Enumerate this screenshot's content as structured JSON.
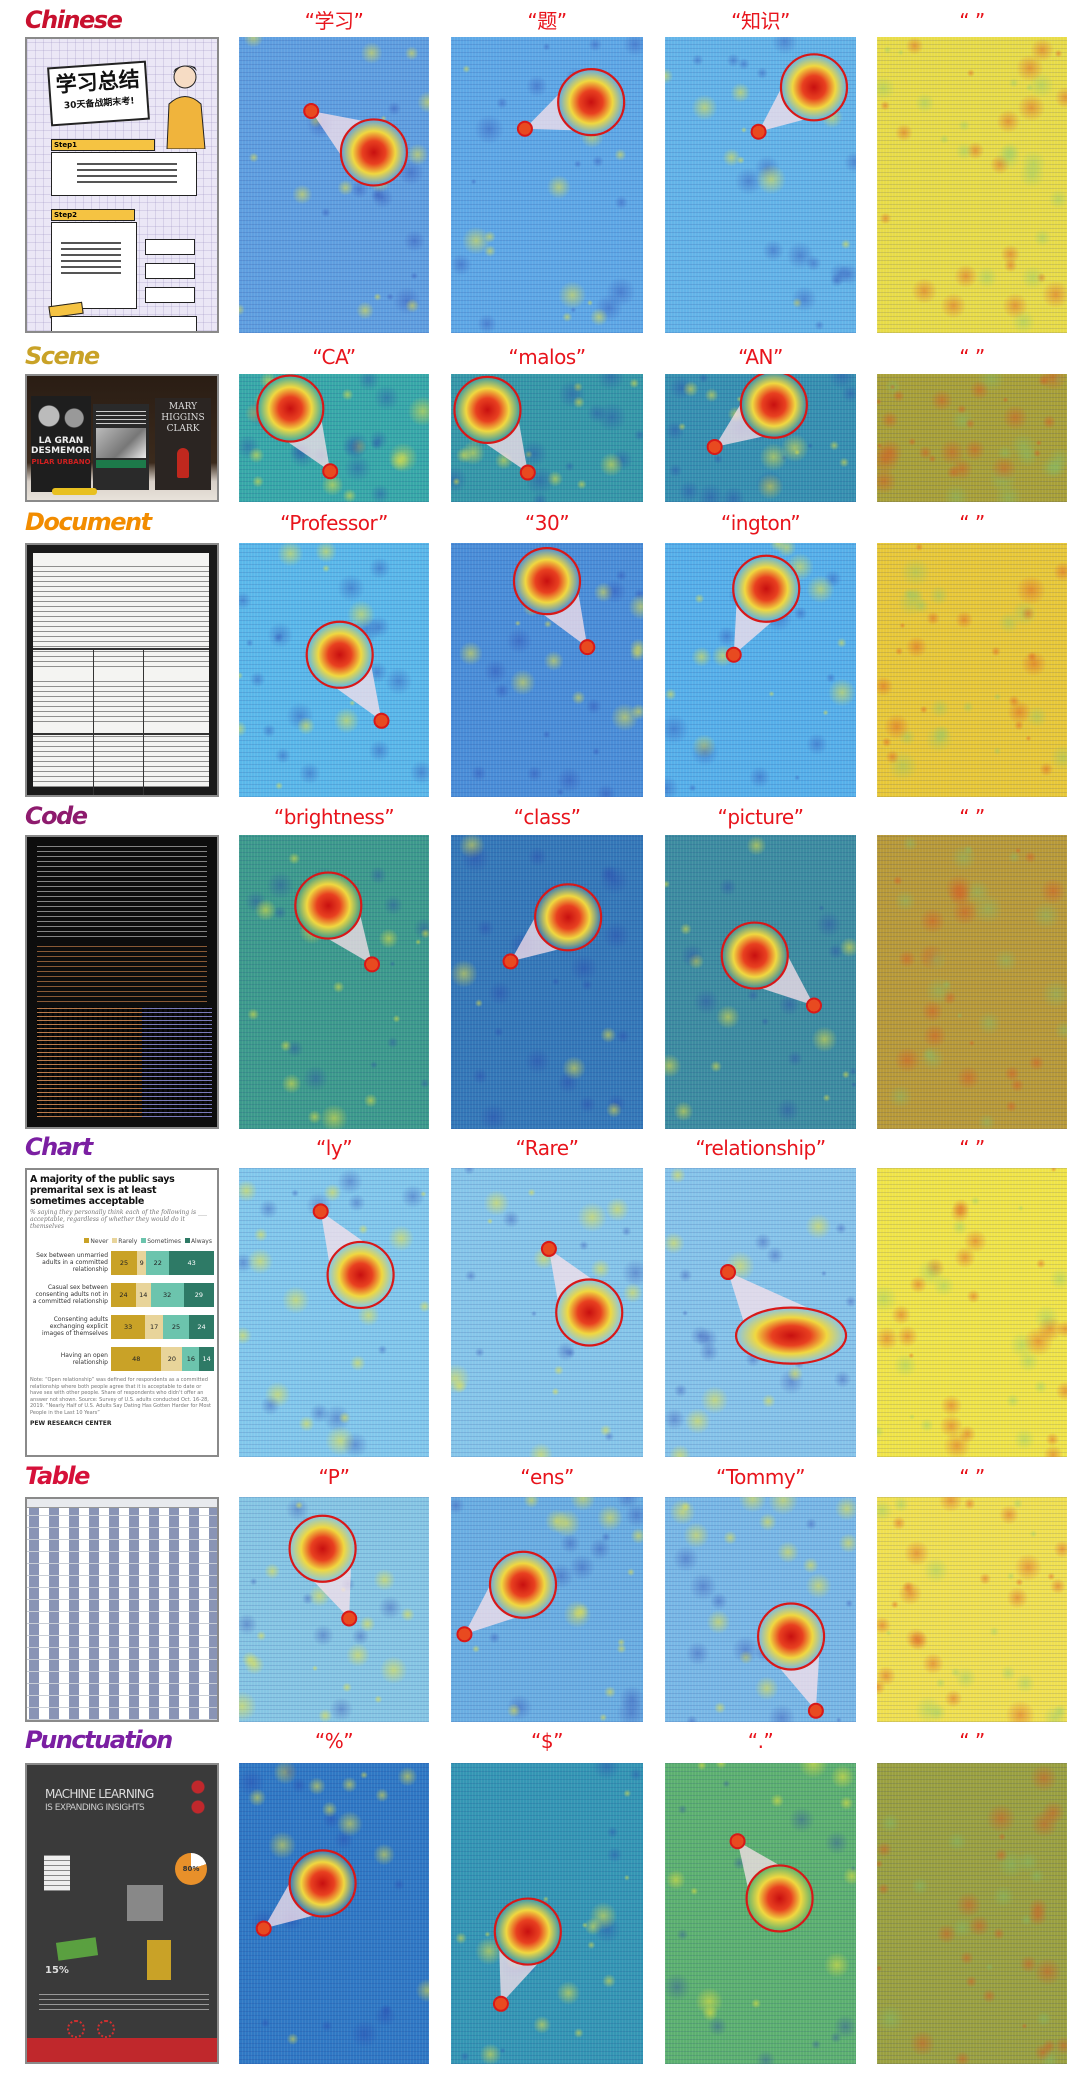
{
  "rows": [
    {
      "category": "Chinese",
      "color": "#c8102e",
      "tokens": [
        "“学习”",
        "“题”",
        "“知识”",
        "“ ”"
      ]
    },
    {
      "category": "Scene",
      "color": "#c9a227",
      "tokens": [
        "“CA”",
        "“malos”",
        "“AN”",
        "“ ”"
      ]
    },
    {
      "category": "Document",
      "color": "#f28c00",
      "tokens": [
        "“Professor”",
        "“30”",
        "“ington”",
        "“ ”"
      ]
    },
    {
      "category": "Code",
      "color": "#8e1b6e",
      "tokens": [
        "“brightness”",
        "“class”",
        "“picture”",
        "“ ”"
      ]
    },
    {
      "category": "Chart",
      "color": "#7b1fa2",
      "tokens": [
        "“ly”",
        "“Rare”",
        "“relationship”",
        "“ ”"
      ]
    },
    {
      "category": "Table",
      "color": "#d6113a",
      "tokens": [
        "“P”",
        "“ens”",
        "“Tommy”",
        "“ ”"
      ]
    },
    {
      "category": "Punctuation",
      "color": "#7b1fa2",
      "tokens": [
        "“%”",
        "“$”",
        "“.”",
        "“ ”"
      ]
    }
  ],
  "token_color": "#e8141c",
  "thumbs": {
    "chinese": {
      "title": "学习总结",
      "subtitle": "30天备战期末考!",
      "step1": "Step1",
      "step2": "Step2"
    },
    "scene": {
      "book1_title": "LA GRAN DESMEMORIA",
      "book1_author": "PILAR URBANO",
      "book3_author": "MARY HIGGINS CLARK"
    },
    "chart": {
      "title": "A majority of the public says premarital sex is at least sometimes acceptable",
      "subtitle": "% saying they personally think each of the following is ___ acceptable, regardless of whether they would do it themselves",
      "legend": [
        "Never",
        "Rarely",
        "Sometimes",
        "Always"
      ],
      "legend_colors": [
        "#c9a227",
        "#e8d49a",
        "#6cc4ad",
        "#2e7a66"
      ],
      "rows": [
        {
          "label": "Sex between unmarried adults in a committed relationship",
          "values": [
            25,
            9,
            22,
            43
          ]
        },
        {
          "label": "Casual sex between consenting adults not in a committed relationship",
          "values": [
            24,
            14,
            32,
            29
          ]
        },
        {
          "label": "Consenting adults exchanging explicit images of themselves",
          "values": [
            33,
            17,
            25,
            24
          ]
        },
        {
          "label": "Having an open relationship",
          "values": [
            48,
            20,
            16,
            14
          ]
        }
      ],
      "note": "Note: “Open relationship” was defined for respondents as a committed relationship where both people agree that it is acceptable to date or have sex with other people. Share of respondents who didn't offer an answer not shown. Source: Survey of U.S. adults conducted Oct. 16-28, 2019. “Nearly Half of U.S. Adults Say Dating Has Gotten Harder for Most People in the Last 10 Years”",
      "source": "PEW RESEARCH CENTER"
    },
    "punctuation": {
      "title1": "MACHINE LEARNING",
      "title2": "IS EXPANDING INSIGHTS",
      "stat1": "80%",
      "stat2": "15%"
    }
  }
}
